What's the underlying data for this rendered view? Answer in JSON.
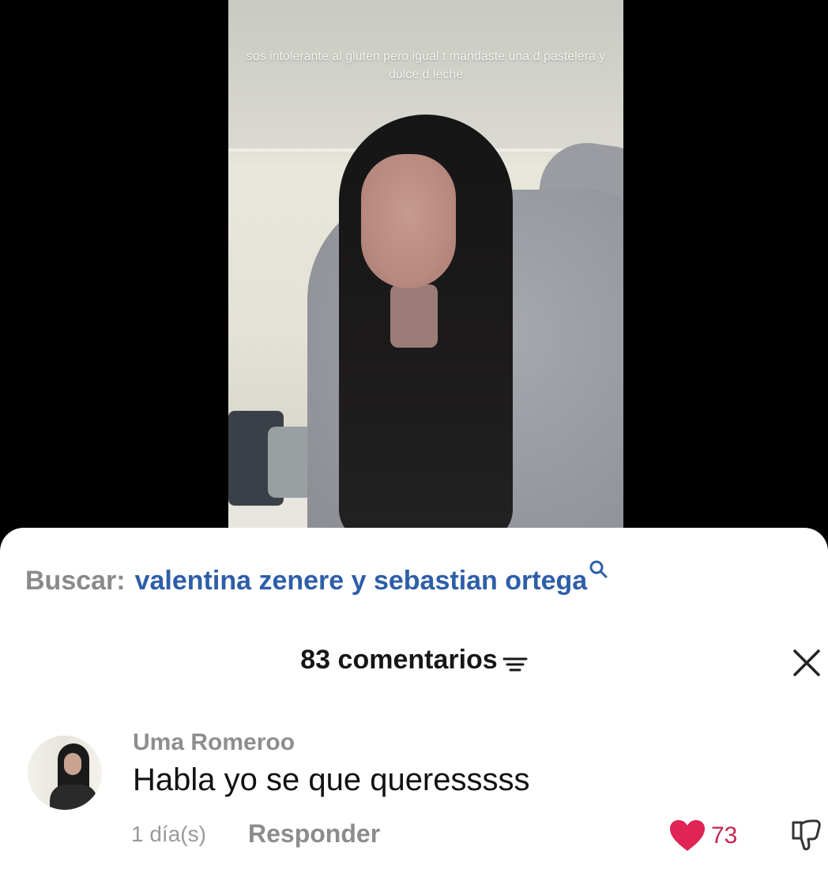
{
  "video": {
    "caption": "sos intolerante al gluten pero igual t mandaste una d pastelera y dulce d leche"
  },
  "search": {
    "prefix": "Buscar:",
    "query": "valentina zenere y sebastian ortega",
    "icon": "search-icon"
  },
  "comments_header": {
    "title": "83 comentarios",
    "filter_icon": "filter-icon",
    "close_icon": "close-icon"
  },
  "comment": {
    "username": "Uma Romeroo",
    "text": "Habla yo se que queresssss",
    "time": "1 día(s)",
    "reply_label": "Responder",
    "like_count": "73",
    "like_color": "#e02454",
    "liked": true
  }
}
